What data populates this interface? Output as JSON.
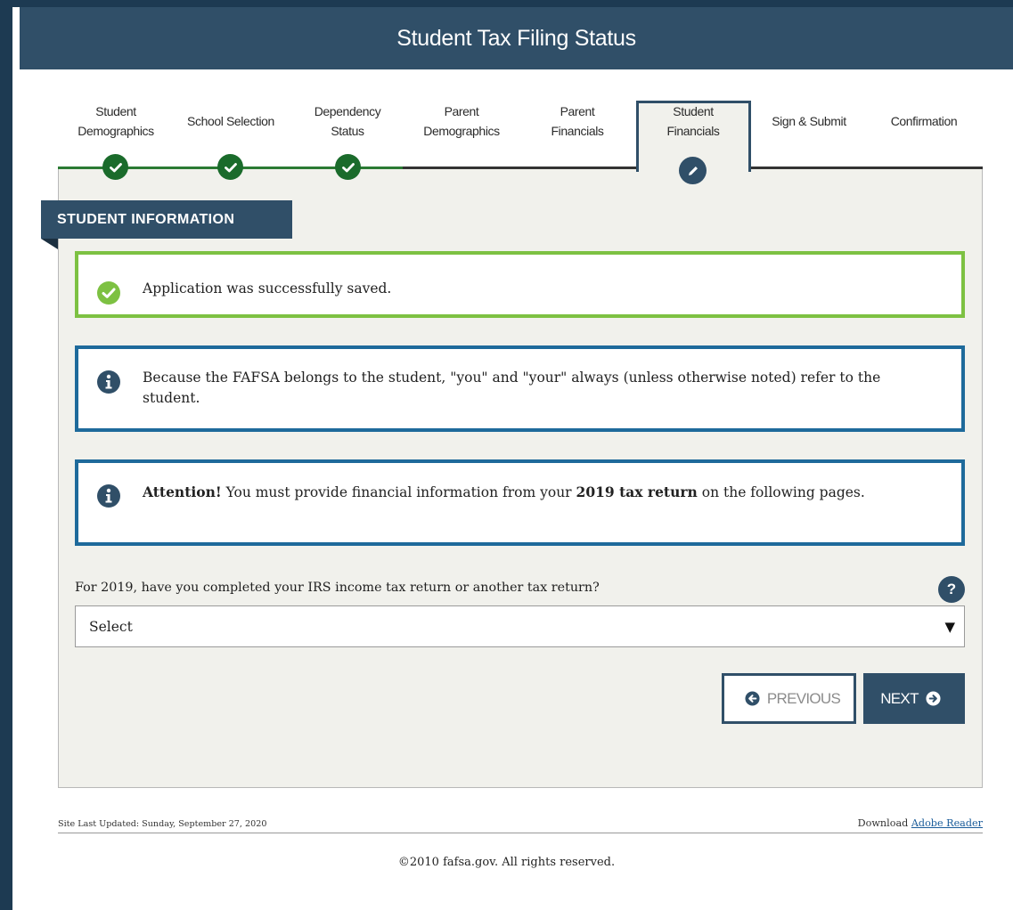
{
  "header": {
    "title": "Student Tax Filing Status"
  },
  "steps": [
    {
      "label": "Student Demographics",
      "status": "complete"
    },
    {
      "label": "School Selection",
      "status": "complete"
    },
    {
      "label": "Dependency Status",
      "status": "complete"
    },
    {
      "label": "Parent Demographics",
      "status": "incomplete"
    },
    {
      "label": "Parent Financials",
      "status": "incomplete"
    },
    {
      "label": "Student Financials",
      "status": "active"
    },
    {
      "label": "Sign & Submit",
      "status": "incomplete"
    },
    {
      "label": "Confirmation",
      "status": "incomplete"
    }
  ],
  "section": {
    "title": "STUDENT INFORMATION"
  },
  "alerts": {
    "success": {
      "icon": "check-circle-icon",
      "text": "Application was successfully saved."
    },
    "info1": {
      "icon": "info-circle-icon",
      "text": "Because the FAFSA belongs to the student, \"you\" and \"your\" always (unless otherwise noted) refer to the student."
    },
    "info2": {
      "icon": "info-circle-icon",
      "bold1": "Attention!",
      "text1": " You must provide financial information from your ",
      "bold2": "2019 tax return",
      "text2": " on the following pages."
    }
  },
  "question": {
    "label": "For 2019, have you completed your IRS income tax return or another tax return?",
    "help": "?",
    "select_value": "Select"
  },
  "buttons": {
    "previous": "PREVIOUS",
    "next": "NEXT"
  },
  "footer": {
    "last_updated": "Site Last Updated: Sunday, September 27, 2020",
    "download_prefix": "Download ",
    "download_link": "Adobe Reader",
    "copyright": "©2010 fafsa.gov. All rights reserved."
  },
  "colors": {
    "brand_navy": "#304f68",
    "success_green": "#7dc142",
    "complete_green": "#1a6b2b",
    "info_blue": "#1e6a9b"
  }
}
